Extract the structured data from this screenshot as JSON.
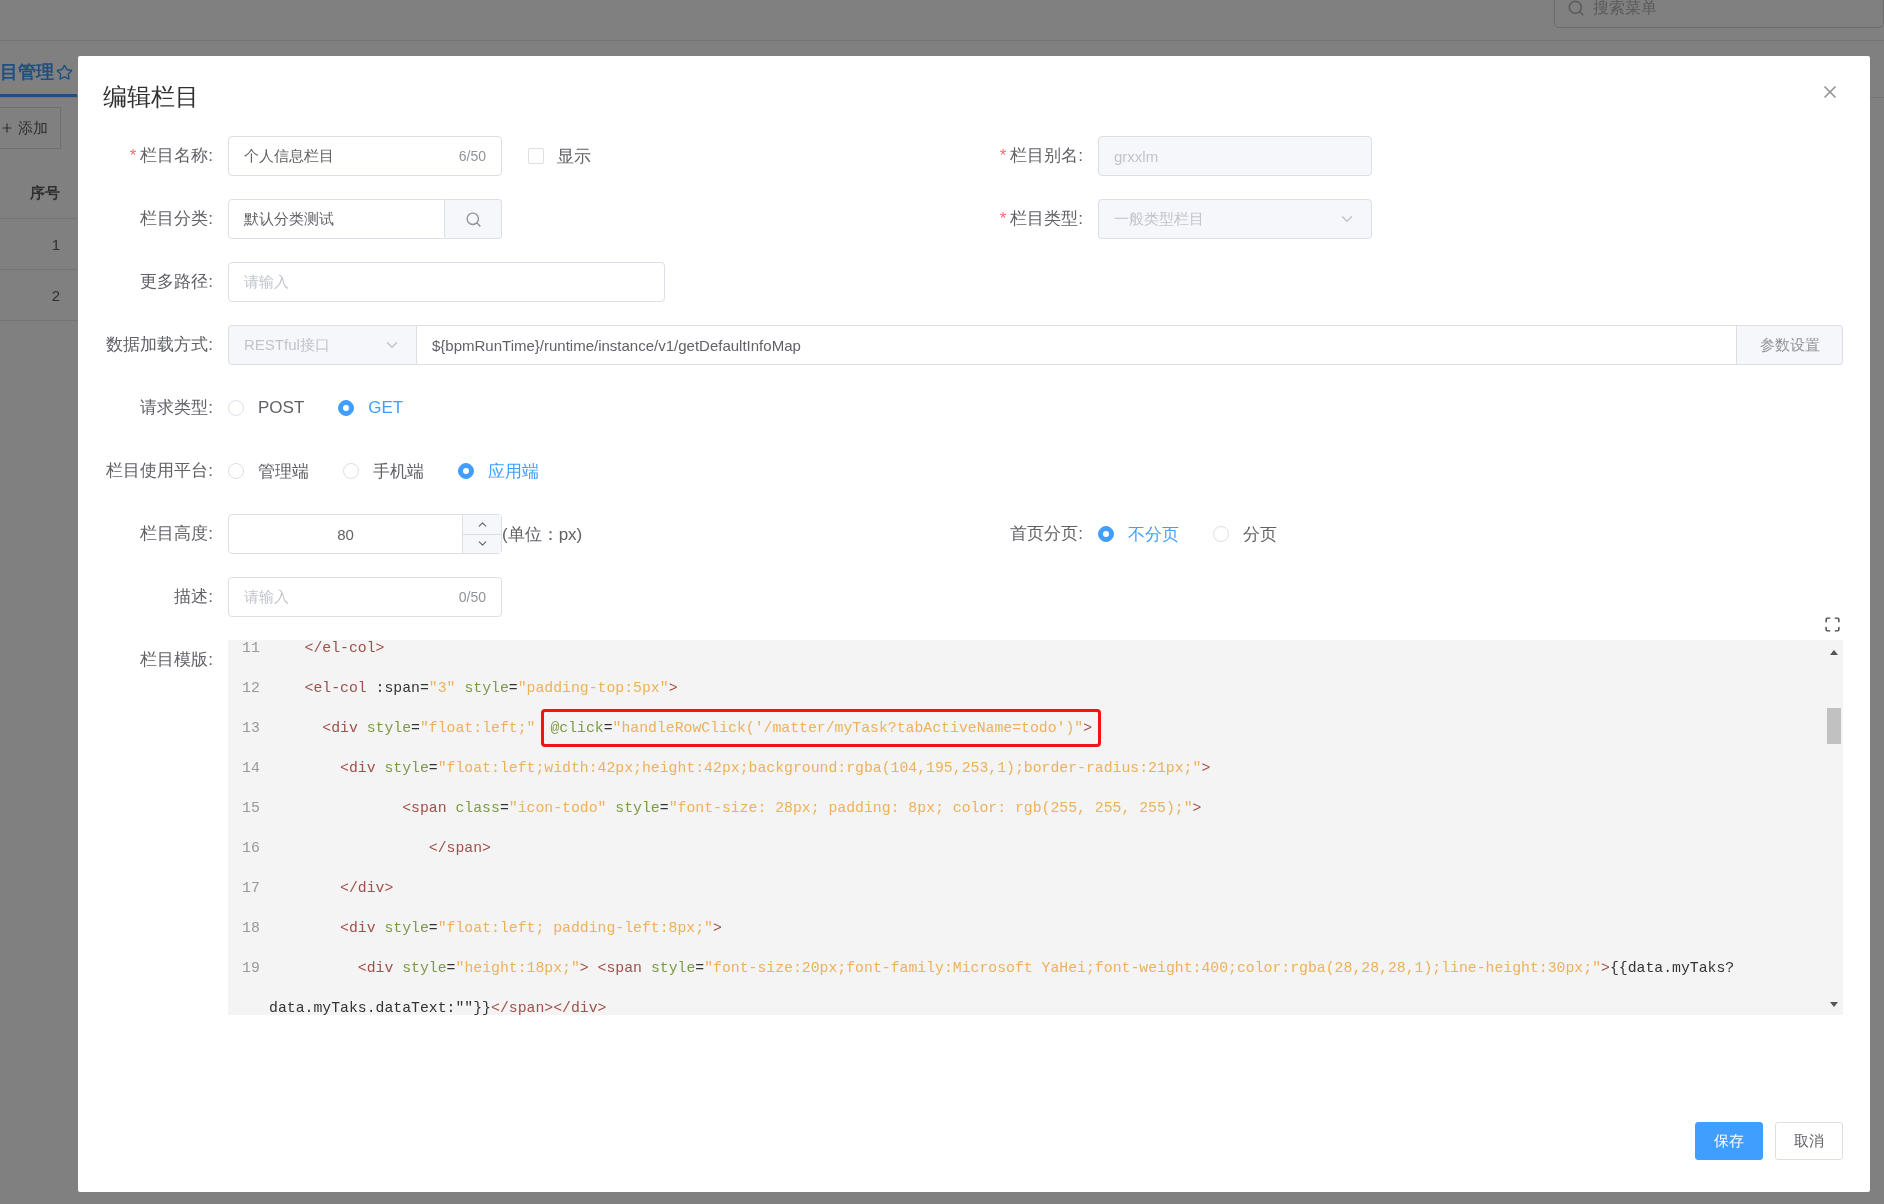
{
  "background": {
    "search": {
      "placeholder": "搜索菜单"
    },
    "tab": {
      "label": "目管理",
      "selected": true
    },
    "toolbar": {
      "add_button": "添加"
    },
    "table": {
      "columns": [
        "序号"
      ],
      "rows": [
        [
          "1"
        ],
        [
          "2"
        ]
      ]
    }
  },
  "dialog": {
    "title": "编辑栏目",
    "rows": [
      {
        "main": {
          "kind": "text",
          "mark": "*",
          "label": "栏目名称:",
          "value": "个人信息栏目",
          "counter": "6/50",
          "disabled": false,
          "checkbox": {
            "label": "显示",
            "checked": false
          }
        },
        "side": {
          "kind": "text",
          "mark": "*",
          "label": "栏目别名:",
          "value": "grxxlm",
          "disabled": true
        }
      },
      {
        "main": {
          "kind": "search",
          "label": "栏目分类:",
          "value": "默认分类测试"
        },
        "side": {
          "kind": "select",
          "mark": "*",
          "label": "栏目类型:",
          "value": "一般类型栏目",
          "disabled": true
        }
      },
      {
        "main": {
          "kind": "text",
          "label": "更多路径:",
          "placeholder": "请输入"
        }
      },
      {
        "main": {
          "kind": "source",
          "label": "数据加载方式:",
          "select": {
            "value": "RESTful接口",
            "disabled": true
          },
          "url": "${bpmRunTime}/runtime/instance/v1/getDefaultInfoMap",
          "button": "参数设置"
        }
      },
      {
        "main": {
          "kind": "radio",
          "label": "请求类型:",
          "options": [
            {
              "label": "POST",
              "selected": false
            },
            {
              "label": "GET",
              "selected": true
            }
          ]
        }
      },
      {
        "main": {
          "kind": "radio",
          "label": "栏目使用平台:",
          "options": [
            {
              "label": "管理端",
              "selected": false
            },
            {
              "label": "手机端",
              "selected": false
            },
            {
              "label": "应用端",
              "selected": true
            }
          ]
        }
      },
      {
        "main": {
          "kind": "number",
          "label": "栏目高度:",
          "value": "80",
          "unit": "(单位：px)"
        },
        "side": {
          "kind": "radio",
          "label": "首页分页:",
          "options": [
            {
              "label": "不分页",
              "selected": true
            },
            {
              "label": "分页",
              "selected": false
            }
          ]
        }
      },
      {
        "main": {
          "kind": "text",
          "label": "描述:",
          "placeholder": "请输入",
          "counter": "0/50"
        }
      },
      {
        "main": {
          "kind": "code",
          "label": "栏目模版:",
          "lines": [
            {
              "number": "11",
              "tokens": [
                {
                  "kind": "tag",
                  "text": "    </el-col>"
                }
              ]
            },
            {
              "number": "12",
              "tokens": [
                {
                  "kind": "tag",
                  "text": "    <el-col"
                },
                {
                  "kind": "plain",
                  "text": " :span"
                },
                {
                  "kind": "plain",
                  "text": "="
                },
                {
                  "kind": "string",
                  "text": "\"3\""
                },
                {
                  "kind": "attr",
                  "text": " style"
                },
                {
                  "kind": "plain",
                  "text": "="
                },
                {
                  "kind": "string",
                  "text": "\"padding-top:5px\""
                },
                {
                  "kind": "tag",
                  "text": ">"
                }
              ]
            },
            {
              "number": "13",
              "tokens": [
                {
                  "kind": "tag",
                  "text": "      <div"
                },
                {
                  "kind": "attr",
                  "text": " style"
                },
                {
                  "kind": "plain",
                  "text": "="
                },
                {
                  "kind": "string",
                  "text": "\"float:left;\""
                },
                {
                  "kind": "box",
                  "tokens": [
                    {
                      "kind": "attr",
                      "text": "@click"
                    },
                    {
                      "kind": "plain",
                      "text": "="
                    },
                    {
                      "kind": "string",
                      "text": "\"handleRowClick('/matter/myTask?tabActiveName=todo')\""
                    },
                    {
                      "kind": "tag",
                      "text": ">"
                    }
                  ]
                }
              ]
            },
            {
              "number": "14",
              "tokens": [
                {
                  "kind": "tag",
                  "text": "        <div"
                },
                {
                  "kind": "attr",
                  "text": " style"
                },
                {
                  "kind": "plain",
                  "text": "="
                },
                {
                  "kind": "string",
                  "text": "\"float:left;width:42px;height:42px;background:rgba(104,195,253,1);border-radius:21px;\""
                },
                {
                  "kind": "tag",
                  "text": ">"
                }
              ]
            },
            {
              "number": "15",
              "tokens": [
                {
                  "kind": "tag",
                  "text": "               <span"
                },
                {
                  "kind": "attr",
                  "text": " class"
                },
                {
                  "kind": "plain",
                  "text": "="
                },
                {
                  "kind": "string",
                  "text": "\"icon-todo\""
                },
                {
                  "kind": "attr",
                  "text": " style"
                },
                {
                  "kind": "plain",
                  "text": "="
                },
                {
                  "kind": "string",
                  "text": "\"font-size: 28px; padding: 8px; color: rgb(255, 255, 255);\""
                },
                {
                  "kind": "tag",
                  "text": ">"
                }
              ]
            },
            {
              "number": "16",
              "tokens": [
                {
                  "kind": "tag",
                  "text": "                  </span>"
                }
              ]
            },
            {
              "number": "17",
              "tokens": [
                {
                  "kind": "tag",
                  "text": "        </div>"
                }
              ]
            },
            {
              "number": "18",
              "tokens": [
                {
                  "kind": "tag",
                  "text": "        <div"
                },
                {
                  "kind": "attr",
                  "text": " style"
                },
                {
                  "kind": "plain",
                  "text": "="
                },
                {
                  "kind": "string",
                  "text": "\"float:left; padding-left:8px;\""
                },
                {
                  "kind": "tag",
                  "text": ">"
                }
              ]
            },
            {
              "number": "19",
              "tokens": [
                {
                  "kind": "tag",
                  "text": "          <div"
                },
                {
                  "kind": "attr",
                  "text": " style"
                },
                {
                  "kind": "plain",
                  "text": "="
                },
                {
                  "kind": "string",
                  "text": "\"height:18px;\""
                },
                {
                  "kind": "tag",
                  "text": ">"
                },
                {
                  "kind": "tag",
                  "text": " <span"
                },
                {
                  "kind": "attr",
                  "text": " style"
                },
                {
                  "kind": "plain",
                  "text": "="
                },
                {
                  "kind": "string",
                  "text": "\"font-size:20px;font-family:Microsoft YaHei;font-weight:400;color:rgba(28,28,28,1);line-height:30px;\""
                },
                {
                  "kind": "tag",
                  "text": ">"
                },
                {
                  "kind": "plain",
                  "text": "{{data.myTaks?"
                }
              ],
              "wrap": [
                {
                  "kind": "plain",
                  "text": "data.myTaks.dataText:\"\"}}"
                },
                {
                  "kind": "tag",
                  "text": "</span></div>"
                }
              ]
            }
          ]
        }
      }
    ],
    "buttons": [
      {
        "label": "保存",
        "kind": "primary"
      },
      {
        "label": "取消",
        "kind": "default"
      }
    ]
  }
}
